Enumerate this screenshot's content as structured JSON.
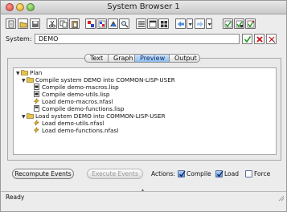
{
  "window": {
    "title": "System Browser 1"
  },
  "toolbar": {
    "buttons": [
      {
        "icon": "new-page-icon"
      },
      {
        "icon": "open-folder-icon"
      },
      {
        "icon": "save-icon"
      },
      {
        "icon": "cut-icon"
      },
      {
        "icon": "copy-icon"
      },
      {
        "icon": "paste-icon"
      },
      {
        "icon": "text-color-icon"
      },
      {
        "icon": "format-icon"
      },
      {
        "icon": "compile-icon"
      },
      {
        "icon": "inspect-icon"
      },
      {
        "icon": "list-view-icon"
      },
      {
        "icon": "window-icon"
      },
      {
        "icon": "grid-view-icon"
      },
      {
        "icon": "back-arrow-icon"
      },
      {
        "icon": "history-dropdown-icon"
      },
      {
        "icon": "forward-arrow-icon"
      },
      {
        "icon": "forward-dropdown-icon"
      },
      {
        "icon": "run-icon"
      },
      {
        "icon": "check-icon"
      },
      {
        "icon": "bookmark-icon"
      }
    ]
  },
  "system": {
    "label": "System:",
    "value": "DEMO"
  },
  "tabs": [
    {
      "label": "Text",
      "active": false
    },
    {
      "label": "Graph",
      "active": false
    },
    {
      "label": "Preview",
      "active": true
    },
    {
      "label": "Output",
      "active": false
    }
  ],
  "tree": {
    "nodes": [
      {
        "label": "Plan",
        "kind": "folder",
        "level": 0,
        "expanded": true
      },
      {
        "label": "Compile system DEMO into COMMON-LISP-USER",
        "kind": "folder",
        "level": 1,
        "expanded": true
      },
      {
        "label": "Compile demo-macros.lisp",
        "kind": "file",
        "level": 2
      },
      {
        "label": "Compile demo-utils.lisp",
        "kind": "file",
        "level": 2
      },
      {
        "label": "Load demo-macros.nfasl",
        "kind": "load",
        "level": 2
      },
      {
        "label": "Compile demo-functions.lisp",
        "kind": "file-alt",
        "level": 2
      },
      {
        "label": "Load system DEMO into COMMON-LISP-USER",
        "kind": "folder",
        "level": 1,
        "expanded": true
      },
      {
        "label": "Load demo-utils.nfasl",
        "kind": "load",
        "level": 2
      },
      {
        "label": "Load demo-functions.nfasl",
        "kind": "load",
        "level": 2
      }
    ]
  },
  "actions": {
    "recompute_label": "Recompute Events",
    "execute_label": "Execute Events",
    "actions_label": "Actions:",
    "compile_label": "Compile",
    "compile_checked": true,
    "load_label": "Load",
    "load_checked": true,
    "force_label": "Force",
    "force_checked": false
  },
  "status": {
    "text": "Ready"
  },
  "colors": {
    "active_tab": "#8fbdf0",
    "error_x": "#d0101a",
    "ok_check": "#1f9a24"
  }
}
